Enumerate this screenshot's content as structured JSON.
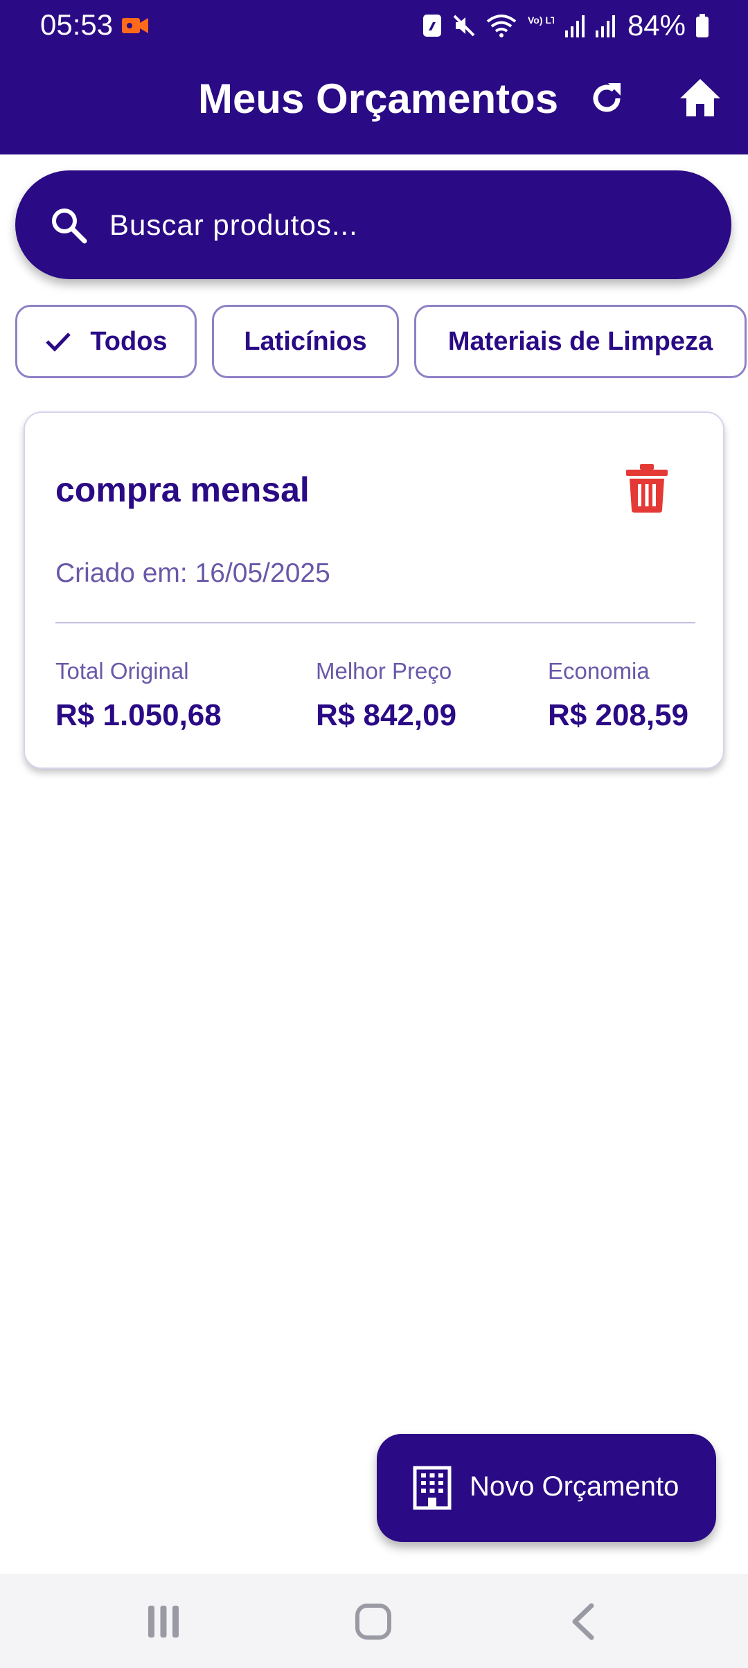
{
  "status_bar": {
    "time": "05:53",
    "battery": "84%",
    "network_label": "Vo) LTE1",
    "icons": [
      "video-record-icon",
      "nfc-icon",
      "mute-icon",
      "wifi-icon",
      "signal-icon",
      "signal-icon",
      "battery-icon"
    ]
  },
  "app_bar": {
    "title": "Meus Orçamentos",
    "actions": [
      "refresh-icon",
      "home-icon"
    ]
  },
  "search": {
    "placeholder": "Buscar produtos...",
    "value": ""
  },
  "filters": [
    {
      "label": "Todos",
      "selected": true
    },
    {
      "label": "Laticínios",
      "selected": false
    },
    {
      "label": "Materiais de Limpeza",
      "selected": false
    }
  ],
  "budgets": [
    {
      "name": "compra mensal",
      "created": "Criado em: 16/05/2025",
      "stats": [
        {
          "label": "Total Original",
          "value": "R$ 1.050,68"
        },
        {
          "label": "Melhor Preço",
          "value": "R$ 842,09"
        },
        {
          "label": "Economia",
          "value": "R$ 208,59"
        }
      ]
    }
  ],
  "fab": {
    "label": "Novo Orçamento",
    "icon": "building-icon"
  },
  "colors": {
    "primary": "#2a0a85",
    "delete": "#e53935",
    "muted_text": "#6b58a8",
    "chip_border": "#8f80c6"
  }
}
